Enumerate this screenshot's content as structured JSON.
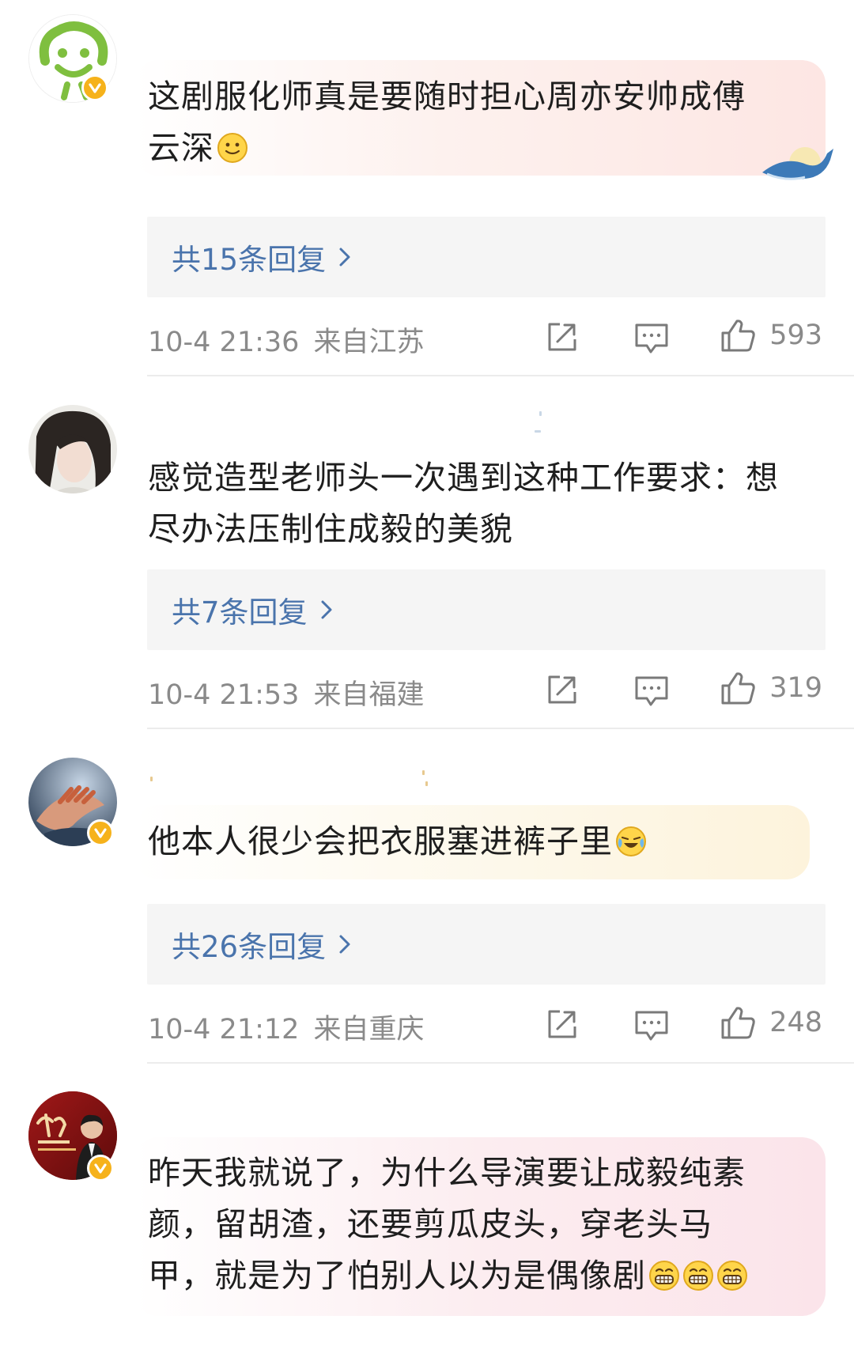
{
  "comments": [
    {
      "text_lines": [
        "这剧服化师真是要随时担心周亦安帅成傅",
        "云深"
      ],
      "emoji": "smile-emoji",
      "replies_label": "共15条回复",
      "time": "10-4 21:36",
      "location": "来自江苏",
      "likes": "593",
      "verified": true,
      "bubble_color": "#fde9e5"
    },
    {
      "text_lines": [
        "感觉造型老师头一次遇到这种工作要求：想",
        "尽办法压制住成毅的美貌"
      ],
      "emoji": "",
      "replies_label": "共7条回复",
      "time": "10-4 21:53",
      "location": "来自福建",
      "likes": "319",
      "verified": false,
      "bubble_color": ""
    },
    {
      "text_lines": [
        "他本人很少会把衣服塞进裤子里"
      ],
      "emoji": "laugh-cry-emoji",
      "replies_label": "共26条回复",
      "time": "10-4 21:12",
      "location": "来自重庆",
      "likes": "248",
      "verified": true,
      "bubble_color": "#fdf6e3"
    },
    {
      "text_lines": [
        "昨天我就说了，为什么导演要让成毅纯素",
        "颜，留胡渣，还要剪瓜皮头，穿老头马",
        "甲，就是为了怕别人以为是偶像剧"
      ],
      "emoji": "grin-emoji x3",
      "verified": true,
      "bubble_color": "#fbe8ec"
    }
  ],
  "icons": {
    "reply_chevron": "›",
    "share": "share-icon",
    "comment": "comment-icon",
    "like": "thumbs-up-icon",
    "verified": "verified-badge-icon"
  },
  "colors": {
    "reply_link": "#4a74ac",
    "meta_text": "#8a8a8a",
    "badge": "#f6b21b"
  }
}
